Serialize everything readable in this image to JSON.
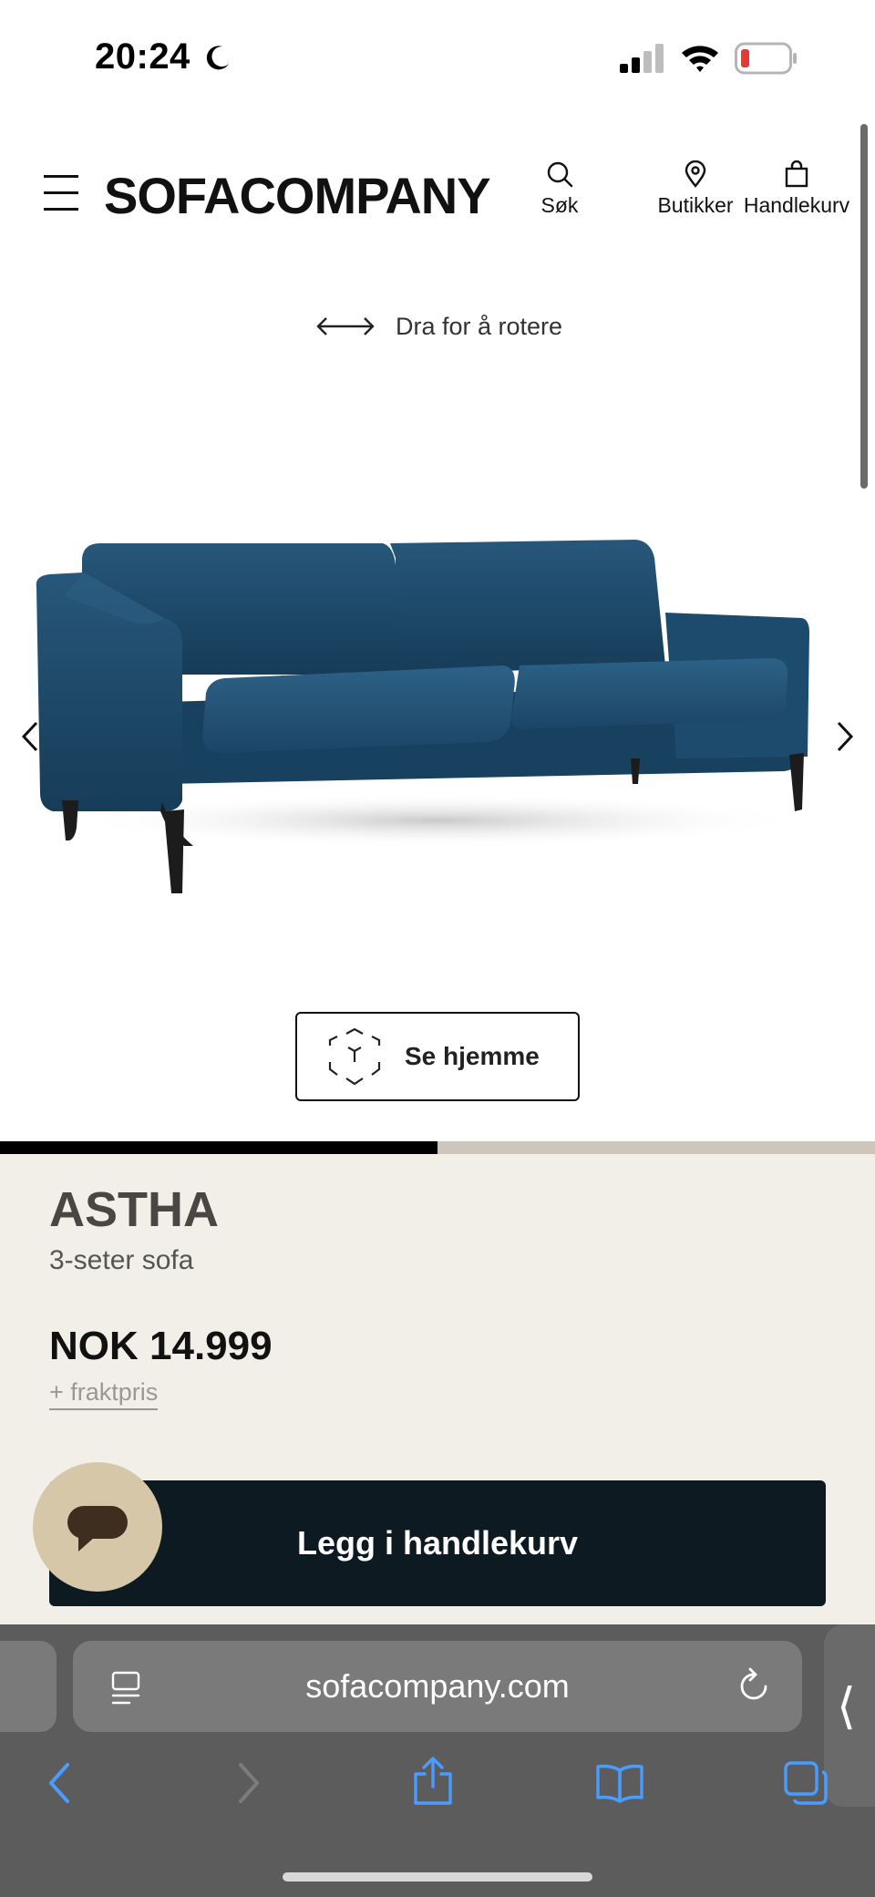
{
  "status_bar": {
    "time": "20:24",
    "battery_color": "#e53935"
  },
  "header": {
    "logo": "SOFACOMPANY",
    "nav": {
      "search": "Søk",
      "stores": "Butikker",
      "cart": "Handlekurv"
    }
  },
  "viewer": {
    "rotate_hint": "Dra for å rotere",
    "ar_button": "Se hjemme",
    "sofa_color": "#1f4e6e",
    "gallery_progress": 0.5
  },
  "product": {
    "name": "ASTHA",
    "subtitle": "3-seter sofa",
    "price": "NOK 14.999",
    "shipping": "+ fraktpris",
    "add_to_cart": "Legg i handlekurv"
  },
  "browser": {
    "url": "sofacompany.com",
    "accent": "#4a9cff"
  }
}
